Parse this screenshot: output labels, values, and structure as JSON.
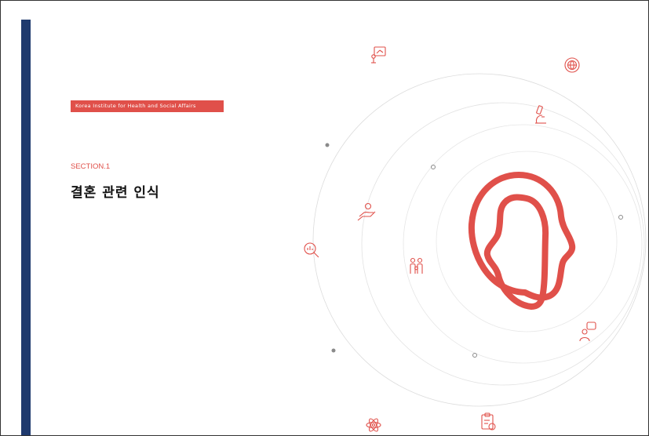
{
  "header": {
    "organization": "Korea Institute for Health and Social Affairs"
  },
  "section": {
    "label": "SECTION.1",
    "title": "결혼 관련 인식"
  },
  "colors": {
    "side_bar": "#1f3a6e",
    "accent": "#e0504a",
    "orbit_lines": "#d8d8d8",
    "nodes": "#8a8a8a",
    "section_label": "#e0504a"
  },
  "icons": [
    "presentation-board-icon",
    "globe-seal-icon",
    "microscope-icon",
    "caring-hand-icon",
    "magnifier-chart-icon",
    "family-icon",
    "speech-person-icon",
    "atom-icon",
    "clipboard-checklist-icon"
  ]
}
